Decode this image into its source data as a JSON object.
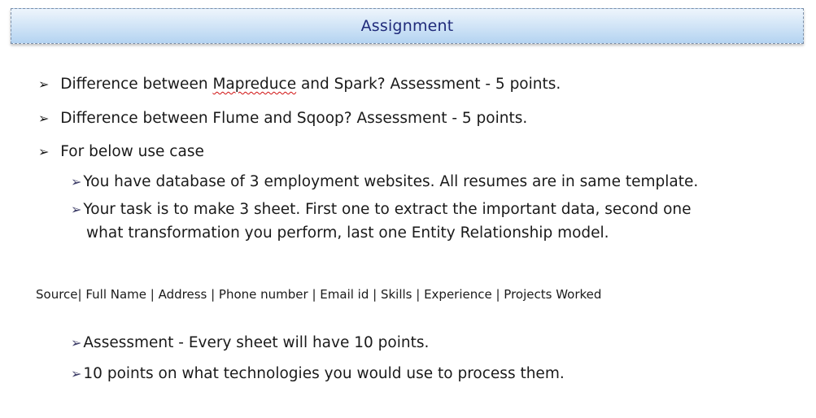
{
  "title": "Assignment",
  "bullets": [
    {
      "pre": "Difference between ",
      "flagged_word": "Mapreduce",
      "post": " and Spark?  Assessment - 5 points."
    },
    {
      "text": "Difference between Flume and Sqoop? Assessment - 5 points."
    },
    {
      "text": "For below use case"
    }
  ],
  "sub_bullets_top": [
    {
      "text": "You have database of 3 employment websites. All resumes are in same template."
    },
    {
      "line1": "Your task is to make 3 sheet. First one to extract the important data, second one",
      "line2": "what transformation you perform, last one Entity Relationship model."
    }
  ],
  "fields_line": "Source| Full Name  | Address | Phone number | Email id | Skills | Experience | Projects Worked",
  "sub_bullets_bottom": [
    {
      "text": "Assessment - Every sheet will have 10 points."
    },
    {
      "text": "10 points on what technologies you would use to process them."
    }
  ]
}
